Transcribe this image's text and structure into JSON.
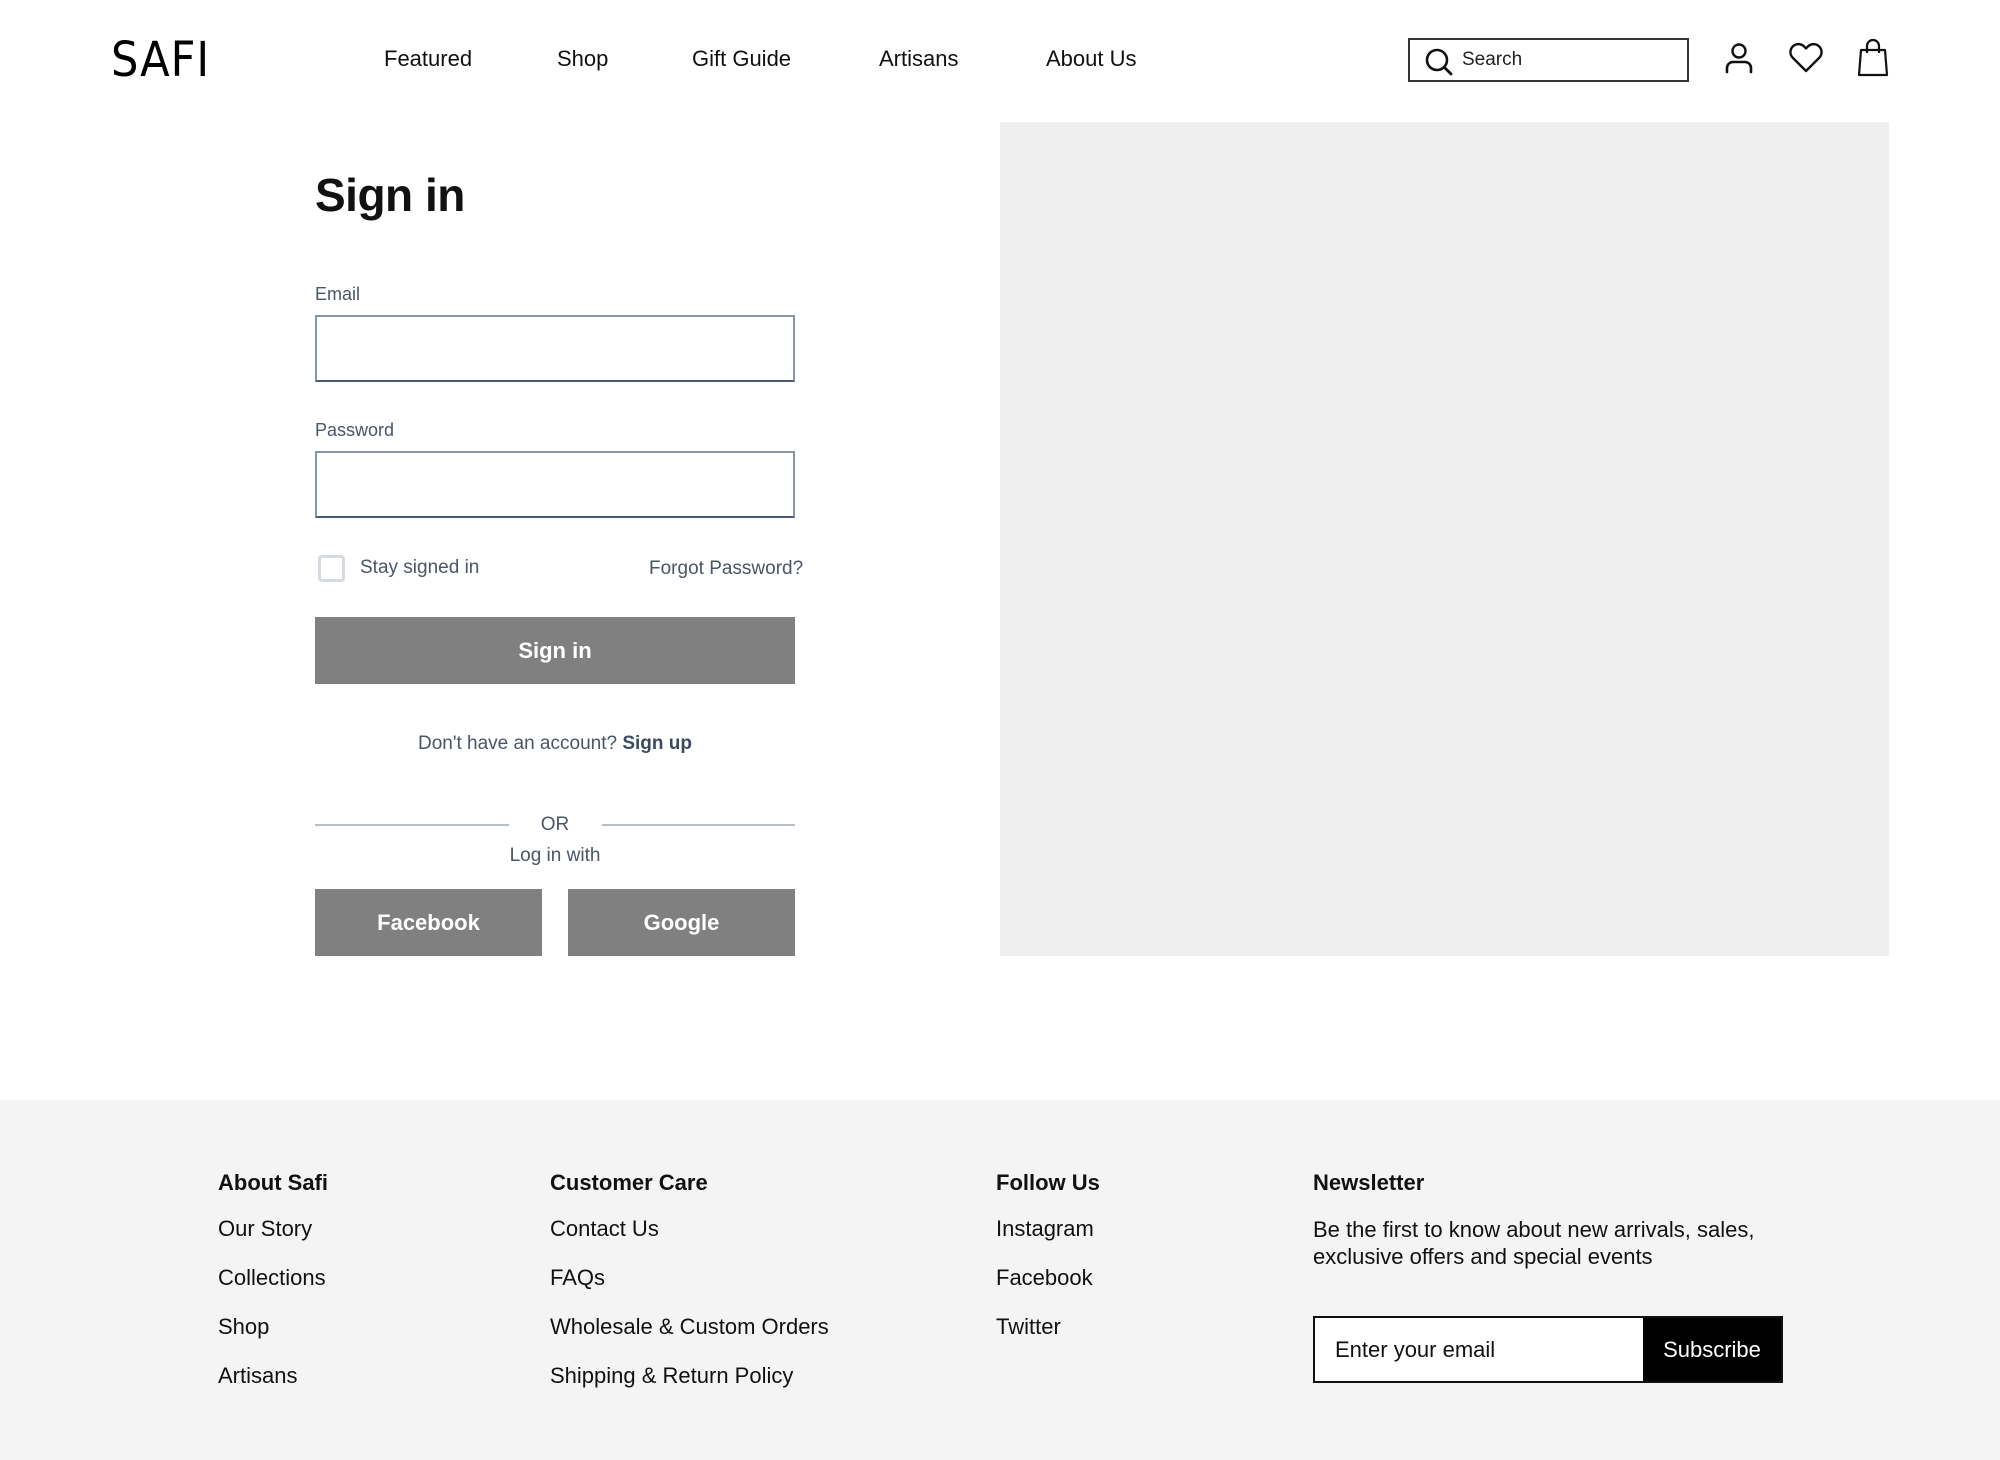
{
  "header": {
    "logo": "SAFI",
    "nav": [
      {
        "label": "Featured"
      },
      {
        "label": "Shop"
      },
      {
        "label": "Gift Guide"
      },
      {
        "label": "Artisans"
      },
      {
        "label": "About Us"
      }
    ],
    "search": {
      "placeholder": "Search",
      "value": ""
    },
    "icons": [
      "search-icon",
      "account-icon",
      "wishlist-heart-icon",
      "shopping-bag-icon"
    ]
  },
  "signin": {
    "title": "Sign in",
    "email_label": "Email",
    "email_value": "",
    "password_label": "Password",
    "password_value": "",
    "stay_signed_in_label": "Stay signed in",
    "stay_signed_in_checked": false,
    "forgot_password": "Forgot Password?",
    "submit_label": "Sign in",
    "no_account_text": "Don't have an account?",
    "signup_link": "Sign up",
    "or_text": "OR",
    "login_with_text": "Log in with",
    "social": [
      {
        "label": "Facebook"
      },
      {
        "label": "Google"
      }
    ]
  },
  "colors": {
    "button_gray": "#808080",
    "image_placeholder": "#efefef",
    "footer_bg": "#f4f4f4",
    "label_slate": "#4a5568"
  },
  "footer": {
    "columns": [
      {
        "title": "About Safi",
        "links": [
          "Our Story",
          "Collections",
          "Shop",
          "Artisans"
        ]
      },
      {
        "title": "Customer Care",
        "links": [
          "Contact Us",
          "FAQs",
          "Wholesale & Custom Orders",
          "Shipping & Return Policy"
        ]
      },
      {
        "title": "Follow Us",
        "links": [
          "Instagram",
          "Facebook",
          "Twitter"
        ]
      }
    ],
    "newsletter": {
      "title": "Newsletter",
      "description": "Be the first to know about new arrivals, sales, exclusive offers and special events",
      "placeholder": "Enter your email",
      "value": "",
      "button_label": "Subscribe"
    }
  }
}
